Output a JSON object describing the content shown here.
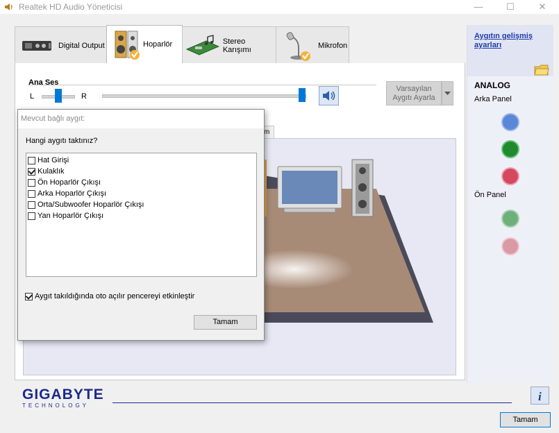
{
  "window": {
    "title": "Realtek HD Audio Yöneticisi",
    "minimize": "—",
    "maximize": "☐",
    "close": "✕"
  },
  "tabs": [
    {
      "label": "Digital Output",
      "icon": "digital-output-icon",
      "active": false
    },
    {
      "label": "Hoparlör",
      "icon": "speaker-icon",
      "active": true
    },
    {
      "label": "Stereo Karışımı",
      "icon": "stereo-mix-icon",
      "active": false
    },
    {
      "label": "Mikrofon",
      "icon": "microphone-icon",
      "active": false
    }
  ],
  "volume": {
    "title": "Ana Ses",
    "left_label": "L",
    "right_label": "R",
    "balance_position": 0.5,
    "level": 1.0
  },
  "default_device": {
    "label_line1": "Varsayılan",
    "label_line2": "Aygıtı Ayarla"
  },
  "subtab_fragment": "im",
  "right_panel": {
    "advanced_link": "Aygıtın gelişmiş ayarları",
    "heading": "ANALOG",
    "back_panel": "Arka Panel",
    "front_panel": "Ön Panel",
    "back_jacks": [
      "#5b87d8",
      "#1f8a2e",
      "#d4495f"
    ],
    "front_jacks": [
      "#6fb07a",
      "#d99aa5"
    ]
  },
  "dialog": {
    "title": "Mevcut bağlı aygıt:",
    "question": "Hangi aygıtı taktınız?",
    "items": [
      {
        "label": "Hat Girişi",
        "checked": false
      },
      {
        "label": "Kulaklık",
        "checked": true
      },
      {
        "label": "Ön Hoparlör Çıkışı",
        "checked": false
      },
      {
        "label": "Arka Hoparlör Çıkışı",
        "checked": false
      },
      {
        "label": "Orta/Subwoofer Hoparlör Çıkışı",
        "checked": false
      },
      {
        "label": "Yan Hoparlör Çıkışı",
        "checked": false
      }
    ],
    "auto_popup_label": "Aygıt takıldığında oto açılır pencereyi etkinleştir",
    "auto_popup_checked": true,
    "ok_button": "Tamam"
  },
  "footer": {
    "brand": "GIGABYTE",
    "brand_sub": "TECHNOLOGY",
    "info_icon": "info-icon",
    "ok_button": "Tamam"
  }
}
